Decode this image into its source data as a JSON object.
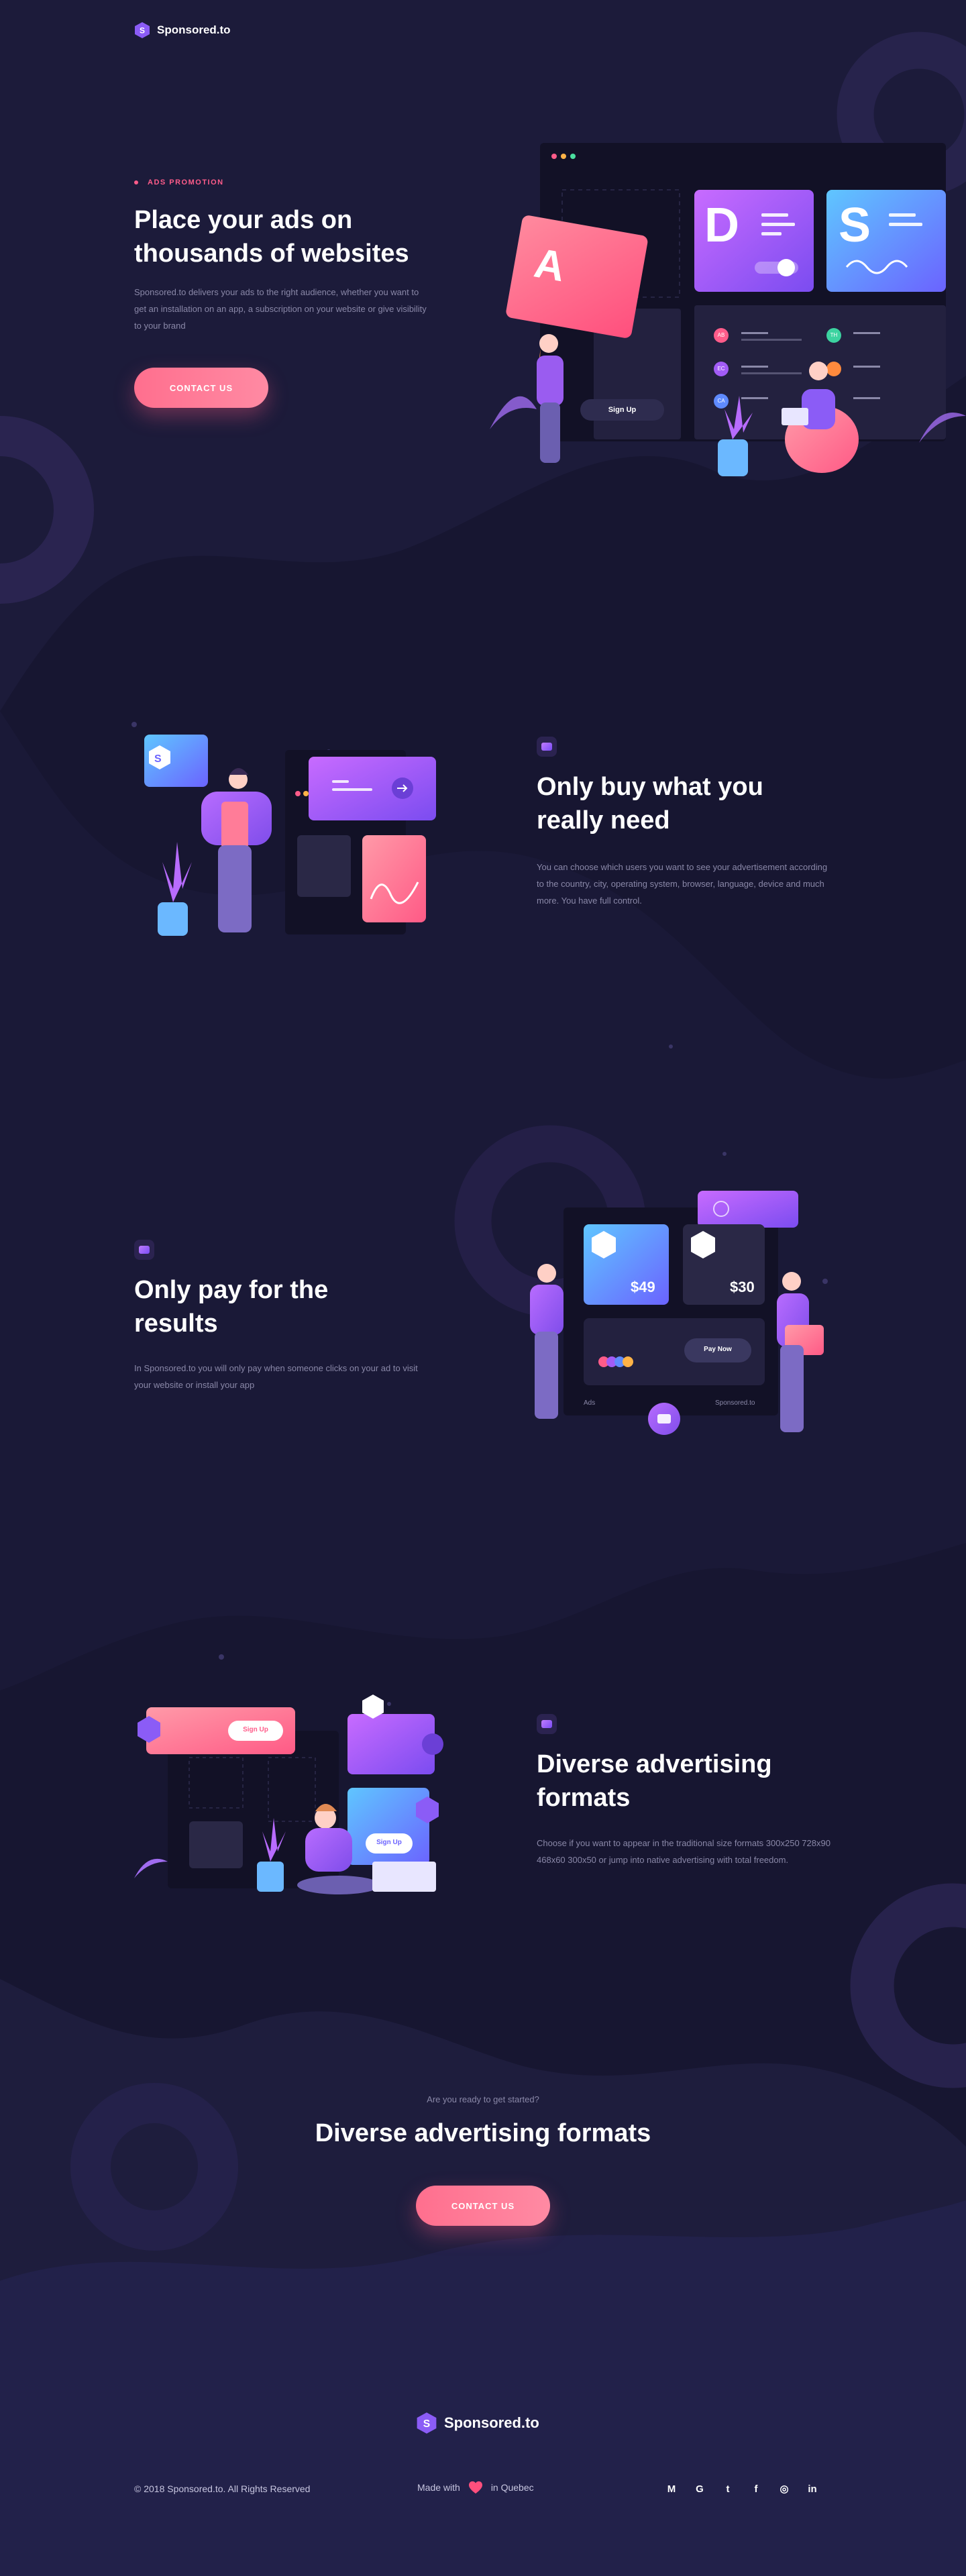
{
  "brand": {
    "name": "Sponsored.to",
    "logo_letter": "S"
  },
  "hero": {
    "eyebrow": "ADS PROMOTION",
    "title": "Place your ads on thousands of websites",
    "description": "Sponsored.to delivers your ads to the right audience, whether you want to get an installation on an app, a subscription on your website or give visibility to your brand",
    "cta": "CONTACT US",
    "illustration": {
      "tile_letters": [
        "A",
        "D",
        "S"
      ],
      "signup_label": "Sign Up",
      "avatar_initials": [
        "AB",
        "TH",
        "EC",
        "CA"
      ]
    }
  },
  "feature1": {
    "title": "Only buy what you really need",
    "description": "You can choose which users you want to see your advertisement according to the country, city, operating system, browser, language, device and much more. You have full control.",
    "icon": "ads-icon"
  },
  "feature2": {
    "title": "Only pay for the results",
    "description": "In Sponsored.to you will only pay when someone clicks on your ad to visit your website or install your app",
    "icon": "card-icon",
    "illustration": {
      "price_1": "$49",
      "price_2": "$30",
      "pay_label": "Pay Now",
      "left_label": "Ads",
      "right_label": "Sponsored.to"
    }
  },
  "feature3": {
    "title": "Diverse advertising formats",
    "description": "Choose if you want to appear in the traditional size formats 300x250 728x90 468x60 300x50 or jump into native advertising with total freedom.",
    "icon": "grid-icon",
    "illustration": {
      "signup_label": "Sign Up"
    }
  },
  "cta_section": {
    "kicker": "Are you ready to get started?",
    "title": "Diverse advertising formats",
    "button": "CONTACT US"
  },
  "footer": {
    "brand": "Sponsored.to",
    "copyright": "© 2018 Sponsored.to. All Rights Reserved",
    "made_with": "Made with",
    "location": "in Quebec",
    "social": [
      "medium-icon",
      "google-icon",
      "twitter-icon",
      "facebook-icon",
      "instagram-icon",
      "linkedin-icon"
    ],
    "social_glyphs": [
      "M",
      "G",
      "t",
      "f",
      "◎",
      "in"
    ]
  },
  "colors": {
    "background": "#171631",
    "accent": "#ff6f8e",
    "purple": "#8b5cf6",
    "muted_text": "#8a88a8"
  }
}
